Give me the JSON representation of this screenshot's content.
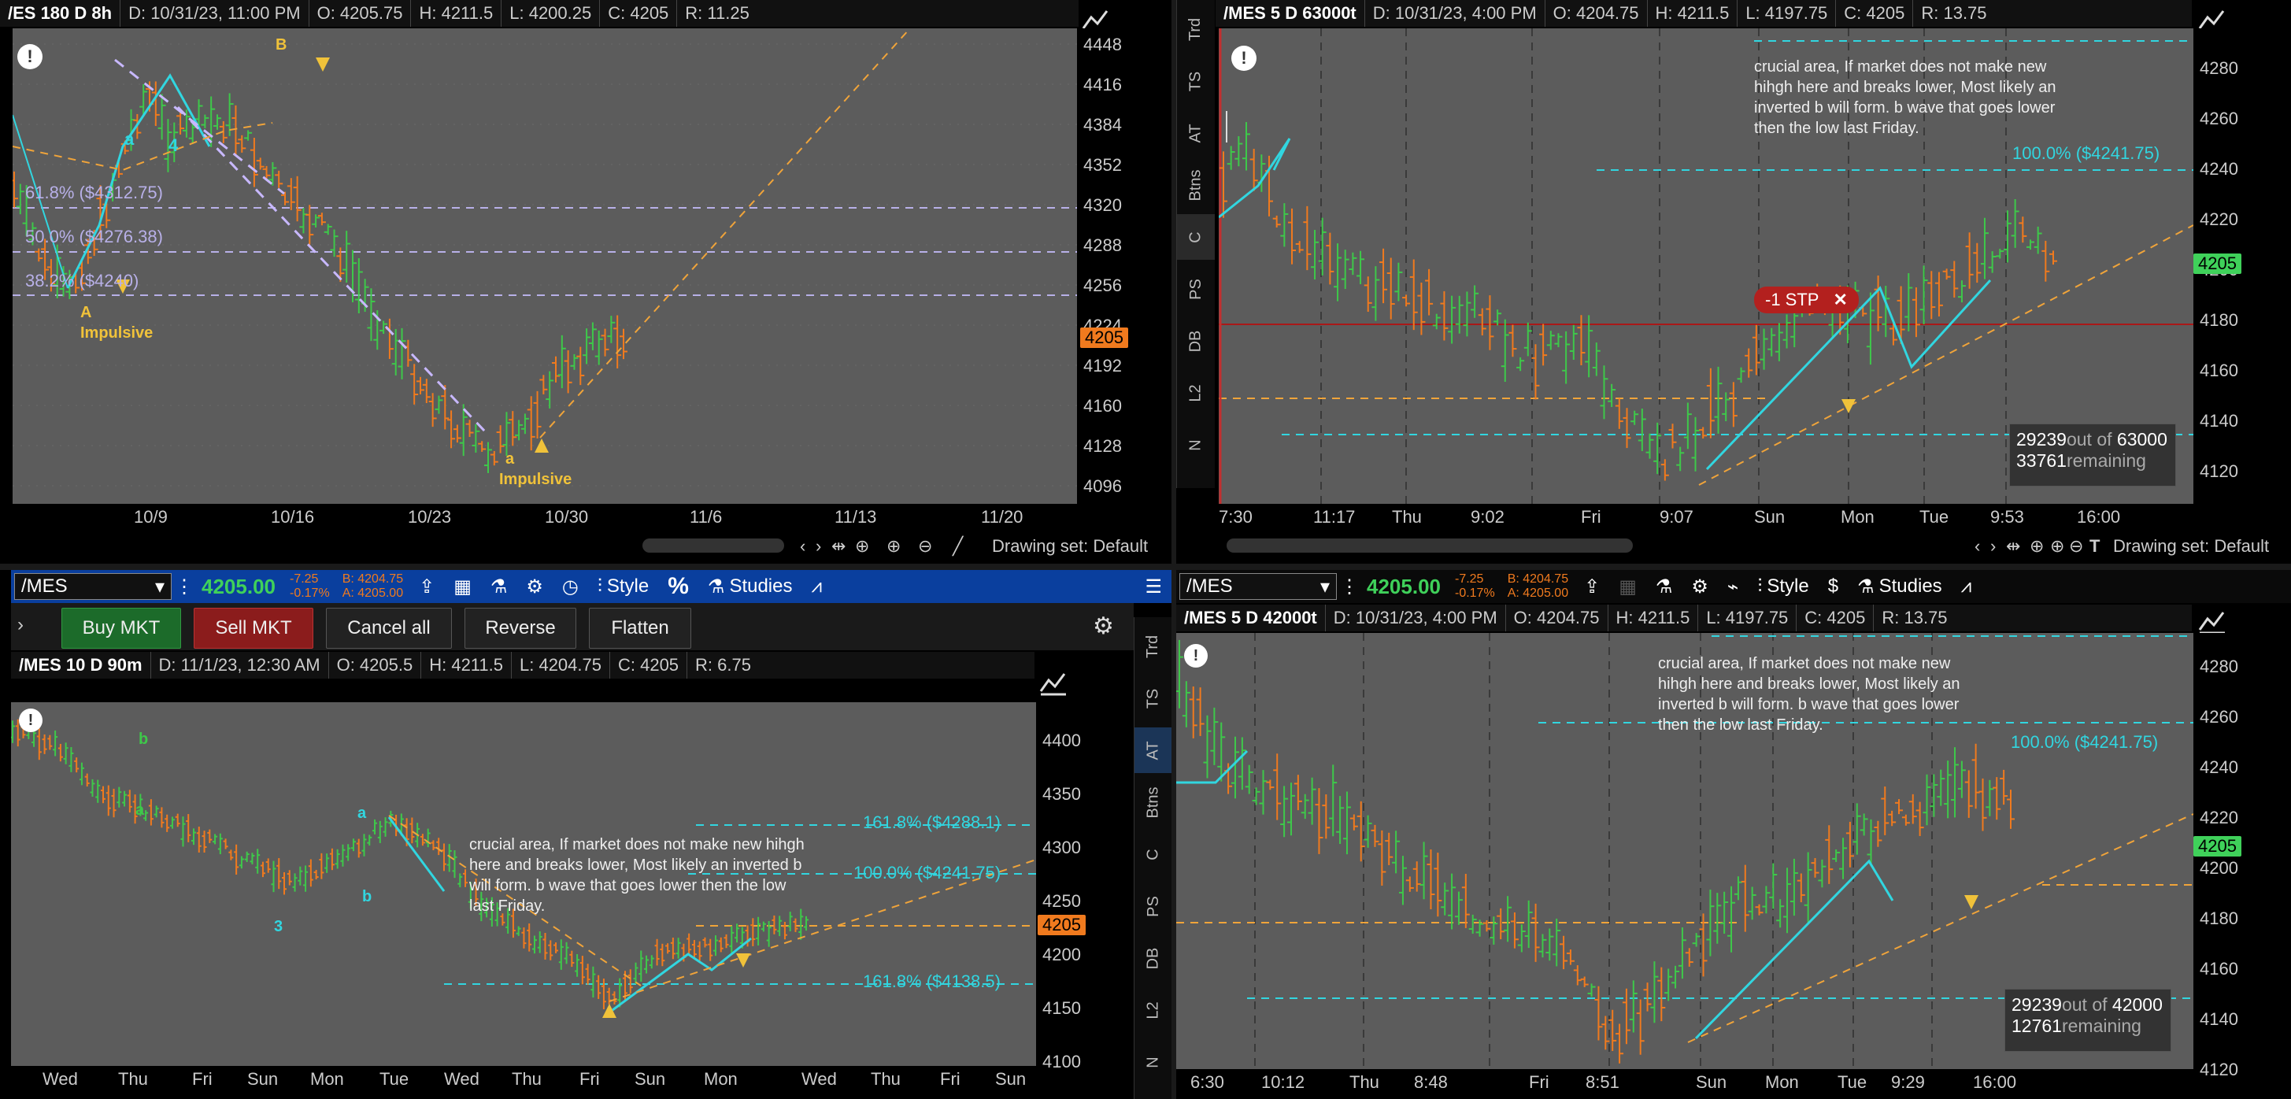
{
  "colors": {
    "up": "#3ec84a",
    "down": "#f07a1e",
    "cyan": "#31d6e0",
    "orange_dash": "#f0a43a",
    "fib_purple": "#b8b0e8",
    "price_up_badge": "#3fd15a",
    "price_badge_orange": "#f07a1e",
    "toolbar_blue": "#0a3f9e",
    "stop_red": "#b3201e"
  },
  "tl": {
    "symbol": "/ES 180 D 8h",
    "date": "D: 10/31/23, 11:00 PM",
    "open": "O: 4205.75",
    "high": "H: 4211.5",
    "low": "L: 4200.25",
    "close": "C: 4205",
    "range": "R: 11.25",
    "price_ticks": [
      "4448",
      "4416",
      "4384",
      "4352",
      "4320",
      "4288",
      "4256",
      "4224",
      "4192",
      "4160",
      "4128",
      "4096"
    ],
    "price_badge": "4205",
    "x_ticks": [
      "10/9",
      "10/16",
      "10/23",
      "10/30",
      "11/6",
      "11/13",
      "11/20"
    ],
    "labels": {
      "a1": "a",
      "b1": "b",
      "n4": "4",
      "B": "B",
      "A": "A",
      "impulsive1": "Impulsive",
      "a2": "a",
      "impulsive2": "Impulsive"
    },
    "fibs": [
      "61.8% ($4312.75)",
      "50.0% ($4276.38)",
      "38.2% ($4240)"
    ],
    "drawing_set": "Drawing set: Default"
  },
  "tr": {
    "symbol": "/MES 5 D 63000t",
    "date": "D: 10/31/23, 4:00 PM",
    "open": "O: 4204.75",
    "high": "H: 4211.5",
    "low": "L: 4197.75",
    "close": "C: 4205",
    "range": "R: 13.75",
    "price_ticks": [
      "4280",
      "4260",
      "4240",
      "4220",
      "4200",
      "4180",
      "4160",
      "4140",
      "4120"
    ],
    "price_badge": "4205",
    "x_ticks": [
      "7:30",
      "11:17",
      "Thu",
      "9:02",
      "Fri",
      "9:07",
      "Sun",
      "Mon",
      "Tue",
      "9:53",
      "16:00"
    ],
    "note": "crucial area, If market does not make new hihgh here and breaks lower, Most likely an inverted b will form. b wave that goes lower then the low last Friday.",
    "fib": "100.0%  ($4241.75)",
    "stop": "-1 STP",
    "tick_count": "29239",
    "tick_out_of": "out of",
    "tick_total": "63000",
    "tick_remaining_num": "33761",
    "tick_remaining": "remaining",
    "drawing_set": "Drawing set: Default",
    "sidebar": [
      "Trd",
      "TS",
      "AT",
      "Btns",
      "C",
      "PS",
      "DB",
      "L2",
      "N"
    ]
  },
  "bl": {
    "symbol_field": "/MES",
    "last": "4205.00",
    "chg": "-7.25",
    "chg_pct": "-0.17%",
    "bid": "B: 4204.75",
    "ask": "A: 4205.00",
    "style": "Style",
    "studies": "Studies",
    "pct": "%",
    "buttons": {
      "buy": "Buy MKT",
      "sell": "Sell MKT",
      "cancel": "Cancel all",
      "reverse": "Reverse",
      "flatten": "Flatten"
    },
    "symbol": "/MES 10 D 90m",
    "date": "D: 11/1/23, 12:30 AM",
    "open": "O: 4205.5",
    "high": "H: 4211.5",
    "low": "L: 4204.75",
    "close": "C: 4205",
    "range": "R: 6.75",
    "price_ticks": [
      "4400",
      "4350",
      "4300",
      "4250",
      "4200",
      "4150",
      "4100"
    ],
    "price_badge": "4205",
    "x_ticks": [
      "Wed",
      "Thu",
      "Fri",
      "Sun",
      "Mon",
      "Tue",
      "Wed",
      "Thu",
      "Fri",
      "Sun",
      "Mon",
      "Wed",
      "Thu",
      "Fri",
      "Sun"
    ],
    "labels": {
      "b": "b",
      "a1": "a",
      "a2": "a",
      "b2": "b",
      "n3": "3"
    },
    "note": "crucial area, If market does not make new hihgh here and breaks lower, Most likely an inverted b will form. b wave that goes lower then the low last Friday.",
    "fibs": [
      "161.8%  ($4288.1)",
      "100.0%  ($4241.75)",
      "161.8%  ($4138.5)"
    ],
    "sidebar": [
      "Trd",
      "TS",
      "AT",
      "Btns",
      "C",
      "PS",
      "DB",
      "L2",
      "N"
    ]
  },
  "br": {
    "symbol_field": "/MES",
    "last": "4205.00",
    "chg": "-7.25",
    "chg_pct": "-0.17%",
    "bid": "B: 4204.75",
    "ask": "A: 4205.00",
    "style": "Style",
    "studies": "Studies",
    "symbol": "/MES 5 D 42000t",
    "date": "D: 10/31/23, 4:00 PM",
    "open": "O: 4204.75",
    "high": "H: 4211.5",
    "low": "L: 4197.75",
    "close": "C: 4205",
    "range": "R: 13.75",
    "price_ticks": [
      "4280",
      "4260",
      "4240",
      "4220",
      "4200",
      "4180",
      "4160",
      "4140",
      "4120"
    ],
    "price_badge": "4205",
    "x_ticks": [
      "6:30",
      "10:12",
      "Thu",
      "8:48",
      "Fri",
      "8:51",
      "Sun",
      "Mon",
      "Tue",
      "9:29",
      "16:00"
    ],
    "note": "crucial area, If market does not make new hihgh here and breaks lower, Most likely an inverted b will form. b wave that goes lower then the low last Friday.",
    "fib": "100.0%  ($4241.75)",
    "tick_count": "29239",
    "tick_out_of": "out of",
    "tick_total": "42000",
    "tick_remaining_num": "12761",
    "tick_remaining": "remaining"
  }
}
